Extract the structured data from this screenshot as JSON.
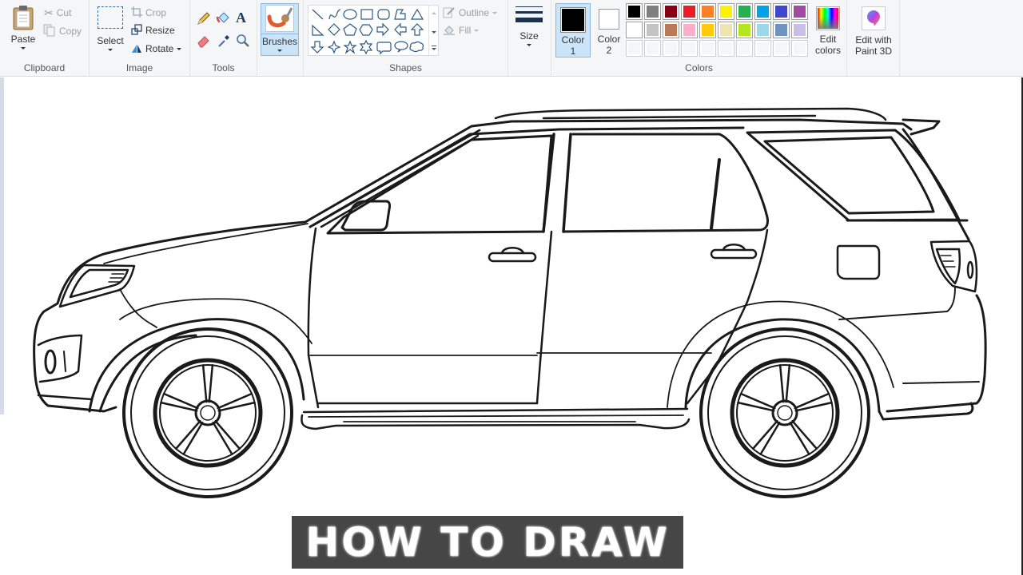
{
  "ribbon": {
    "clipboard": {
      "group_label": "Clipboard",
      "paste": "Paste",
      "cut": "Cut",
      "copy": "Copy"
    },
    "image": {
      "group_label": "Image",
      "select": "Select",
      "crop": "Crop",
      "resize": "Resize",
      "rotate": "Rotate"
    },
    "tools": {
      "group_label": "Tools",
      "items": [
        "pencil-icon",
        "fill-bucket-icon",
        "text-icon",
        "eraser-icon",
        "color-picker-icon",
        "magnifier-icon"
      ]
    },
    "brushes": {
      "label": "Brushes"
    },
    "shapes": {
      "group_label": "Shapes",
      "outline": "Outline",
      "fill": "Fill",
      "items": [
        "line",
        "curve",
        "oval",
        "rectangle",
        "rounded-rectangle",
        "polygon",
        "triangle",
        "right-triangle",
        "diamond",
        "pentagon",
        "hexagon",
        "right-arrow",
        "left-arrow",
        "up-arrow",
        "down-arrow",
        "four-point-star",
        "five-point-star",
        "six-point-star",
        "rounded-callout",
        "oval-callout",
        "cloud-callout"
      ]
    },
    "size": {
      "label": "Size"
    },
    "colors": {
      "group_label": "Colors",
      "color1_label": "Color",
      "color1_num": "1",
      "color2_label": "Color",
      "color2_num": "2",
      "color1_value": "#000000",
      "color2_value": "#ffffff",
      "palette_row1": [
        "#000000",
        "#7f7f7f",
        "#880015",
        "#ed1c24",
        "#ff7f27",
        "#fff200",
        "#22b14c",
        "#00a2e8",
        "#3f48cc",
        "#a349a4"
      ],
      "palette_row2": [
        "#ffffff",
        "#c3c3c3",
        "#b97a57",
        "#ffaec9",
        "#ffc90e",
        "#efe4b0",
        "#b5e61d",
        "#99d9ea",
        "#7092be",
        "#c8bfe7"
      ],
      "palette_row3_empty": 10,
      "edit_colors_line1": "Edit",
      "edit_colors_line2": "colors"
    },
    "paint3d": {
      "line1": "Edit with",
      "line2": "Paint 3D"
    }
  },
  "canvas": {
    "drawing": "SUV car line drawing (side view)",
    "banner_text": "HOW TO DRAW"
  }
}
